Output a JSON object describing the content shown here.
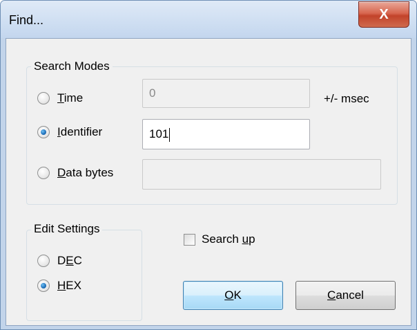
{
  "window": {
    "title": "Find...",
    "close_label": "X"
  },
  "search_modes": {
    "label": "Search Modes",
    "time": {
      "label_prefix": "",
      "label_mnemonic": "T",
      "label_rest": "ime",
      "value": "0",
      "unit": "+/- msec",
      "selected": false
    },
    "identifier": {
      "label_mnemonic": "I",
      "label_rest": "dentifier",
      "value": "101",
      "selected": true
    },
    "data_bytes": {
      "label_mnemonic": "D",
      "label_rest": "ata bytes",
      "value": "",
      "selected": false
    }
  },
  "edit_settings": {
    "label": "Edit Settings",
    "dec": {
      "label_pre": "D",
      "label_mnemonic": "E",
      "label_rest": "C",
      "selected": false
    },
    "hex": {
      "label_mnemonic": "H",
      "label_rest": "EX",
      "selected": true
    }
  },
  "search_up": {
    "label_pre": "Search ",
    "label_mnemonic": "u",
    "label_rest": "p",
    "checked": false
  },
  "buttons": {
    "ok": {
      "label_mnemonic": "O",
      "label_rest": "K"
    },
    "cancel": {
      "label_mnemonic": "C",
      "label_rest": "ancel"
    }
  }
}
